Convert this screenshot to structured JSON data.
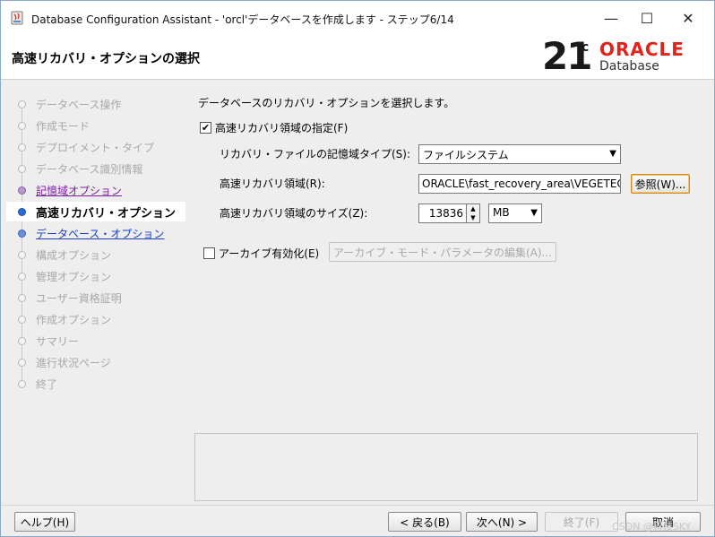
{
  "window": {
    "title": "Database Configuration Assistant - 'orcl'データベースを作成します - ステップ6/14",
    "minimize": "—",
    "maximize": "☐",
    "close": "✕"
  },
  "header": {
    "page_title": "高速リカバリ・オプションの選択",
    "logo_version": "21",
    "logo_sup": "c",
    "logo_brand": "ORACLE",
    "logo_product": "Database"
  },
  "nav": {
    "items": [
      {
        "label": "データベース操作",
        "state": "disabled"
      },
      {
        "label": "作成モード",
        "state": "disabled"
      },
      {
        "label": "デプロイメント・タイプ",
        "state": "disabled"
      },
      {
        "label": "データベース識別情報",
        "state": "disabled"
      },
      {
        "label": "記憶域オプション",
        "state": "visited"
      },
      {
        "label": "高速リカバリ・オプション",
        "state": "current"
      },
      {
        "label": "データベース・オプション",
        "state": "link"
      },
      {
        "label": "構成オプション",
        "state": "disabled"
      },
      {
        "label": "管理オプション",
        "state": "disabled"
      },
      {
        "label": "ユーザー資格証明",
        "state": "disabled"
      },
      {
        "label": "作成オプション",
        "state": "disabled"
      },
      {
        "label": "サマリー",
        "state": "disabled"
      },
      {
        "label": "進行状況ページ",
        "state": "disabled"
      },
      {
        "label": "終了",
        "state": "disabled"
      }
    ]
  },
  "content": {
    "intro": "データベースのリカバリ・オプションを選択します。",
    "fra_checkbox_label": "高速リカバリ領域の指定(F)",
    "fra_checked": true,
    "storage_type_label": "リカバリ・ファイルの記憶域タイプ(S):",
    "storage_type_value": "ファイルシステム",
    "fra_location_label": "高速リカバリ領域(R):",
    "fra_location_value": "ORACLE\\fast_recovery_area\\VEGETECH",
    "browse_button": "参照(W)...",
    "fra_size_label": "高速リカバリ領域のサイズ(Z):",
    "fra_size_value": "13836",
    "fra_size_unit": "MB",
    "archive_checkbox_label": "アーカイブ有効化(E)",
    "archive_checked": false,
    "archive_params_button": "アーカイブ・モード・パラメータの編集(A)..."
  },
  "footer": {
    "help": "ヘルプ(H)",
    "back": "< 戻る(B)",
    "next": "次へ(N) >",
    "finish": "終了(F)",
    "cancel": "取消",
    "watermark": "CSDN @科技SKY"
  }
}
